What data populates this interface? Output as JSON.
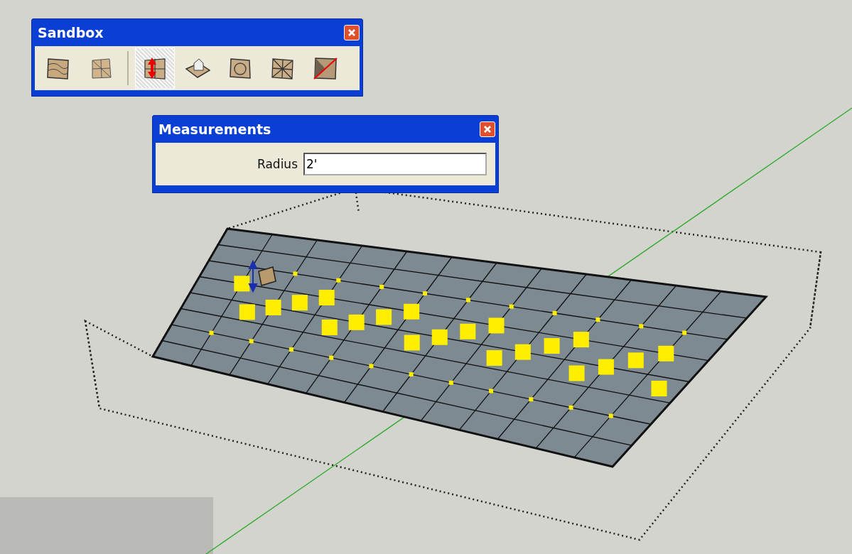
{
  "sandbox_toolbar": {
    "title": "Sandbox",
    "tools": [
      {
        "kind": "contours",
        "selected": false
      },
      {
        "kind": "scratch",
        "selected": false
      },
      {
        "kind": "smoove",
        "selected": true
      },
      {
        "kind": "stamp",
        "selected": false
      },
      {
        "kind": "drape",
        "selected": false
      },
      {
        "kind": "detail",
        "selected": false
      },
      {
        "kind": "flip",
        "selected": false
      }
    ]
  },
  "measurements": {
    "title": "Measurements",
    "label": "Radius",
    "value": "2'"
  }
}
